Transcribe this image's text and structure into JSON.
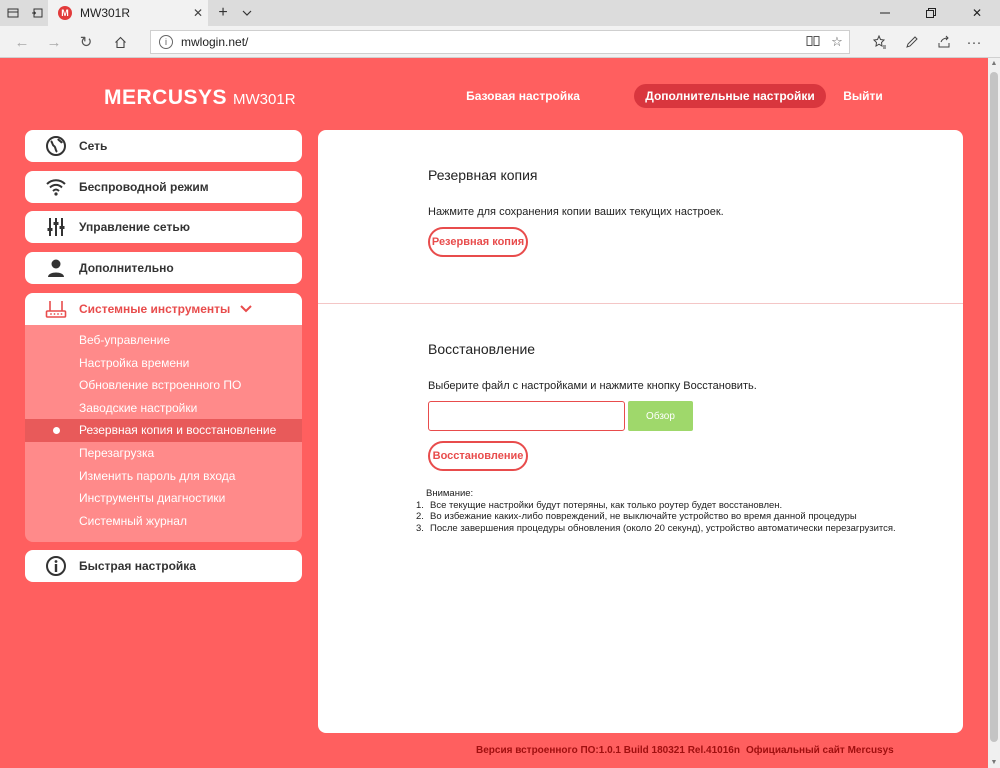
{
  "browser": {
    "tab_title": "MW301R",
    "favicon_letter": "M",
    "url": "mwlogin.net/"
  },
  "header": {
    "brand": "MERCUSYS",
    "model": "MW301R",
    "nav": [
      {
        "label": "Базовая настройка"
      },
      {
        "label": "Дополнительные настройки"
      },
      {
        "label": "Выйти"
      }
    ]
  },
  "sidebar": {
    "items": [
      {
        "label": "Сеть",
        "icon": "globe-icon"
      },
      {
        "label": "Беспроводной режим",
        "icon": "wifi-icon"
      },
      {
        "label": "Управление сетью",
        "icon": "sliders-icon"
      },
      {
        "label": "Дополнительно",
        "icon": "user-icon"
      },
      {
        "label": "Системные инструменты",
        "icon": "router-icon"
      },
      {
        "label": "Быстрая настройка",
        "icon": "info-icon"
      }
    ],
    "submenu": [
      {
        "label": "Веб-управление"
      },
      {
        "label": "Настройка времени"
      },
      {
        "label": "Обновление встроенного ПО"
      },
      {
        "label": "Заводские настройки"
      },
      {
        "label": "Резервная копия и восстановление"
      },
      {
        "label": "Перезагрузка"
      },
      {
        "label": "Изменить пароль для входа"
      },
      {
        "label": "Инструменты диагностики"
      },
      {
        "label": "Системный журнал"
      }
    ]
  },
  "main": {
    "backup": {
      "title": "Резервная копия",
      "description": "Нажмите для сохранения копии ваших текущих настроек.",
      "button": "Резервная копия"
    },
    "restore": {
      "title": "Восстановление",
      "description": "Выберите файл с настройками и нажмите кнопку Восстановить.",
      "file_value": "",
      "browse_button": "Обзор",
      "button": "Восстановление"
    },
    "notes": {
      "heading": "Внимание:",
      "items": [
        {
          "num": "1.",
          "text": "Все текущие настройки будут потеряны, как только роутер будет восстановлен."
        },
        {
          "num": "2.",
          "text": "Во избежание каких-либо повреждений, не выключайте устройство во время данной процедуры"
        },
        {
          "num": "3.",
          "text": "После завершения процедуры обновления (около 20 секунд), устройство автоматически перезагрузится."
        }
      ]
    }
  },
  "footer": {
    "firmware": "Версия встроенного ПО:1.0.1 Build 180321 Rel.41016n",
    "site_link": "Официальный сайт Mercusys"
  },
  "colors": {
    "background": "#ff5f5f",
    "accent": "#e84c4c",
    "active_nav": "#d9363e",
    "submenu_bg": "#ff8a8a",
    "browse_button": "#9fd86b",
    "footer_text": "#a01010"
  }
}
